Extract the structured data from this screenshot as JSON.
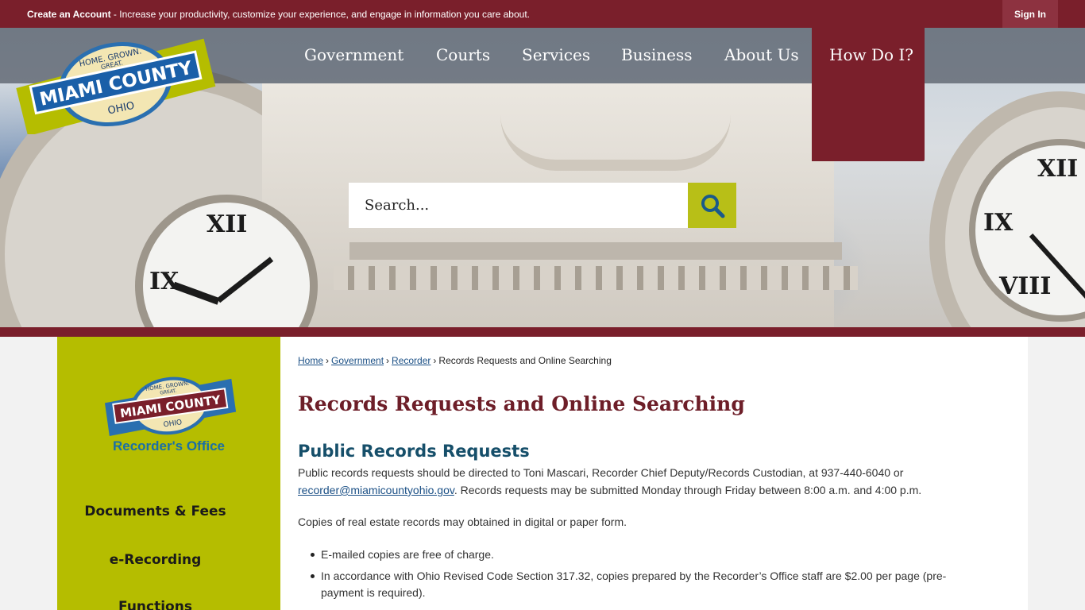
{
  "topbar": {
    "create_account": "Create an Account",
    "tagline": " - Increase your productivity, customize your experience, and engage in information you care about.",
    "sign_in": "Sign In"
  },
  "logo": {
    "line1": "HOME. GROWN.",
    "line2": "GREAT.",
    "name": "MIAMI COUNTY",
    "state": "OHIO"
  },
  "nav": {
    "items": [
      "Government",
      "Courts",
      "Services",
      "Business",
      "About Us",
      "How Do I?"
    ]
  },
  "search": {
    "placeholder": "Search..."
  },
  "sidebar": {
    "office": "Recorder's Office",
    "items": [
      "Documents & Fees",
      "e-Recording",
      "Functions"
    ]
  },
  "breadcrumb": {
    "home": "Home",
    "government": "Government",
    "recorder": "Recorder",
    "current": "Records Requests and Online Searching"
  },
  "main": {
    "title": "Records Requests and Online Searching",
    "section_title": "Public Records Requests",
    "para1_a": "Public records requests should be directed to Toni Mascari, Recorder Chief Deputy/Records Custodian, at 937-440-6040 or",
    "para1_email": "recorder@miamicountyohio.gov",
    "para1_b": ".  Records requests may be submitted Monday through Friday between 8:00 a.m. and 4:00 p.m.",
    "para2": "Copies of real estate records may obtained in digital or paper form.",
    "bullets": [
      "E-mailed copies are free of charge.",
      " In accordance with Ohio Revised Code Section 317.32, copies prepared by the Recorder’s Office staff are $2.00 per page (pre-payment is required)."
    ]
  },
  "colors": {
    "maroon": "#7a1f2b",
    "lime": "#b5bd00",
    "logo_blue": "#1a6fa6",
    "heading_blue": "#164f6a"
  }
}
